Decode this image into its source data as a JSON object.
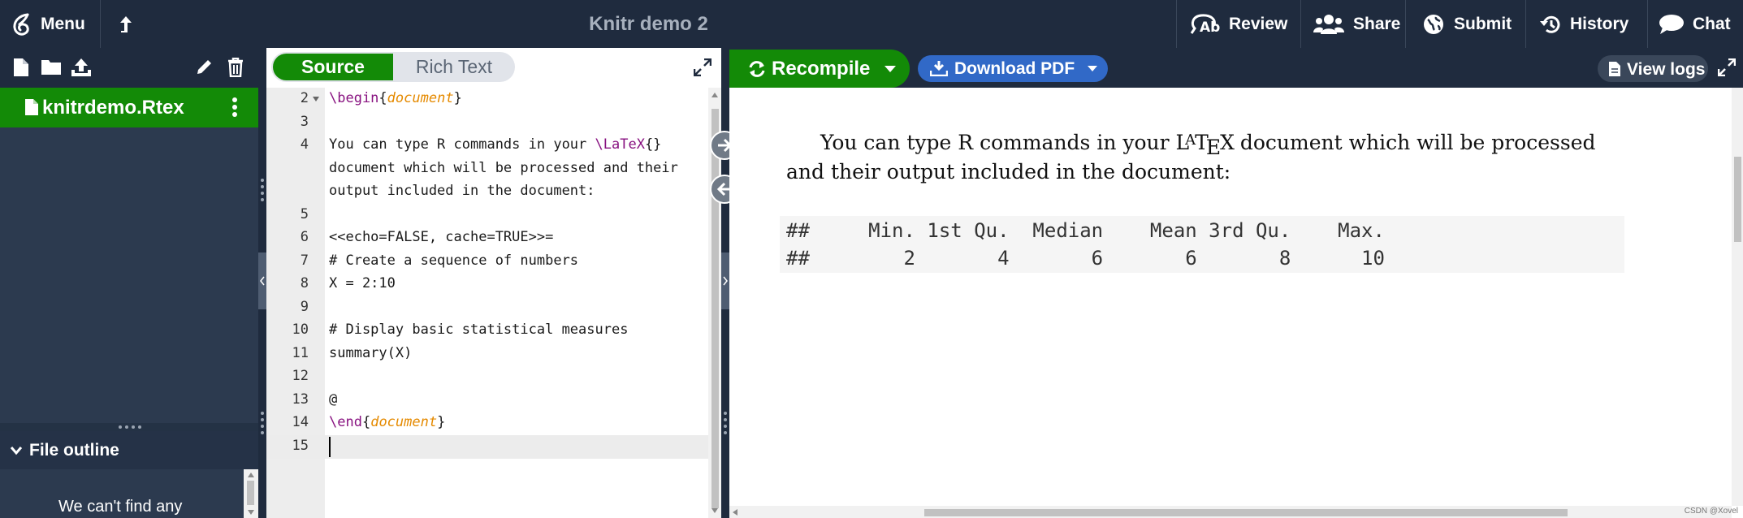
{
  "topbar": {
    "menu_label": "Menu",
    "title": "Knitr demo 2",
    "review_label": "Review",
    "share_label": "Share",
    "submit_label": "Submit",
    "history_label": "History",
    "chat_label": "Chat"
  },
  "file_tree": {
    "selected_file": "knitrdemo.Rtex"
  },
  "outline": {
    "label": "File outline",
    "message": "We can't find any"
  },
  "editor_toolbar": {
    "source_label": "Source",
    "rich_text_label": "Rich Text"
  },
  "editor": {
    "lines": [
      {
        "n": "2"
      },
      {
        "n": "3"
      },
      {
        "n": "4"
      },
      {
        "n": "",
        "text": "document which will be processed and their"
      },
      {
        "n": "",
        "text": "output included in the document:"
      },
      {
        "n": "5"
      },
      {
        "n": "6",
        "text": "<<echo=FALSE, cache=TRUE>>="
      },
      {
        "n": "7",
        "text": "# Create a sequence of numbers"
      },
      {
        "n": "8",
        "text": "X = 2:10"
      },
      {
        "n": "9"
      },
      {
        "n": "10",
        "text": "# Display basic statistical measures"
      },
      {
        "n": "11",
        "text": "summary(X)"
      },
      {
        "n": "12"
      },
      {
        "n": "13",
        "text": "@"
      },
      {
        "n": "14"
      },
      {
        "n": "15"
      }
    ],
    "l2_cmd": "\\begin",
    "l2_arg": "document",
    "l4_pre": "You can type R commands in your ",
    "l4_cmd": "\\LaTeX",
    "l14_cmd": "\\end",
    "l14_arg": "document"
  },
  "pdf_toolbar": {
    "recompile_label": "Recompile",
    "download_label": "Download PDF",
    "logs_label": "View logs"
  },
  "pdf": {
    "para_line1_pre": "You can type R commands in your ",
    "para_line1_post": " document which will be processed",
    "para_line2": "and their output included in the document:",
    "code_row1": "##     Min. 1st Qu.  Median    Mean 3rd Qu.    Max.",
    "code_row2": "##        2       4       6       6       8      10",
    "watermark": "CSDN @Xovel"
  },
  "colors": {
    "green": "#138a07",
    "navy": "#1f2b3e",
    "blue": "#3169c7"
  }
}
